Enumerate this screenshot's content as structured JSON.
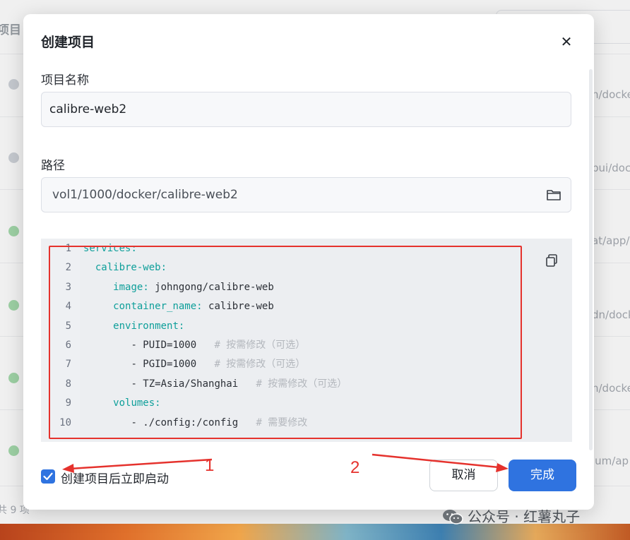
{
  "background": {
    "header_title": "项目",
    "row_paths": [
      "n/docke",
      "bui/dock",
      "at/app/",
      "dn/dock",
      "n/docke",
      "ium/ap"
    ],
    "row_status_colors": [
      "#d1d5db",
      "#d1d5db",
      "#a6dcae",
      "#a6dcae",
      "#a6dcae",
      "#a6dcae"
    ],
    "footer_count": "共 9 项"
  },
  "modal": {
    "title": "创建项目",
    "close_icon": "close-icon",
    "name_label": "项目名称",
    "name_value": "calibre-web2",
    "path_label": "路径",
    "path_value": "vol1/1000/docker/calibre-web2",
    "path_icon": "folder-icon",
    "copy_icon": "copy-icon",
    "compose_lines": [
      {
        "n": "1",
        "indent": "",
        "key": "services",
        "sep": ":",
        "val": "",
        "comment": ""
      },
      {
        "n": "2",
        "indent": "  ",
        "key": "calibre-web",
        "sep": ":",
        "val": "",
        "comment": ""
      },
      {
        "n": "3",
        "indent": "     ",
        "key": "image",
        "sep": ": ",
        "val": "johngong/calibre-web",
        "comment": ""
      },
      {
        "n": "4",
        "indent": "     ",
        "key": "container_name",
        "sep": ": ",
        "val": "calibre-web",
        "comment": ""
      },
      {
        "n": "5",
        "indent": "     ",
        "key": "environment",
        "sep": ":",
        "val": "",
        "comment": ""
      },
      {
        "n": "6",
        "indent": "        ",
        "key": "",
        "sep": "",
        "val": "- PUID=1000   ",
        "comment": "# 按需修改（可选）"
      },
      {
        "n": "7",
        "indent": "        ",
        "key": "",
        "sep": "",
        "val": "- PGID=1000   ",
        "comment": "# 按需修改（可选）"
      },
      {
        "n": "8",
        "indent": "        ",
        "key": "",
        "sep": "",
        "val": "- TZ=Asia/Shanghai   ",
        "comment": "# 按需修改（可选）"
      },
      {
        "n": "9",
        "indent": "     ",
        "key": "volumes",
        "sep": ":",
        "val": "",
        "comment": ""
      },
      {
        "n": "10",
        "indent": "        ",
        "key": "",
        "sep": "",
        "val": "- ./config:/config   ",
        "comment": "# 需要修改"
      }
    ],
    "autostart_label": "创建项目后立即启动",
    "autostart_checked": true,
    "cancel_label": "取消",
    "confirm_label": "完成",
    "accent_color": "#2f73e0"
  },
  "annotations": {
    "marker_1": "1",
    "marker_2": "2",
    "color": "#e5322d"
  },
  "watermark": "公众号 · 红薯丸子"
}
